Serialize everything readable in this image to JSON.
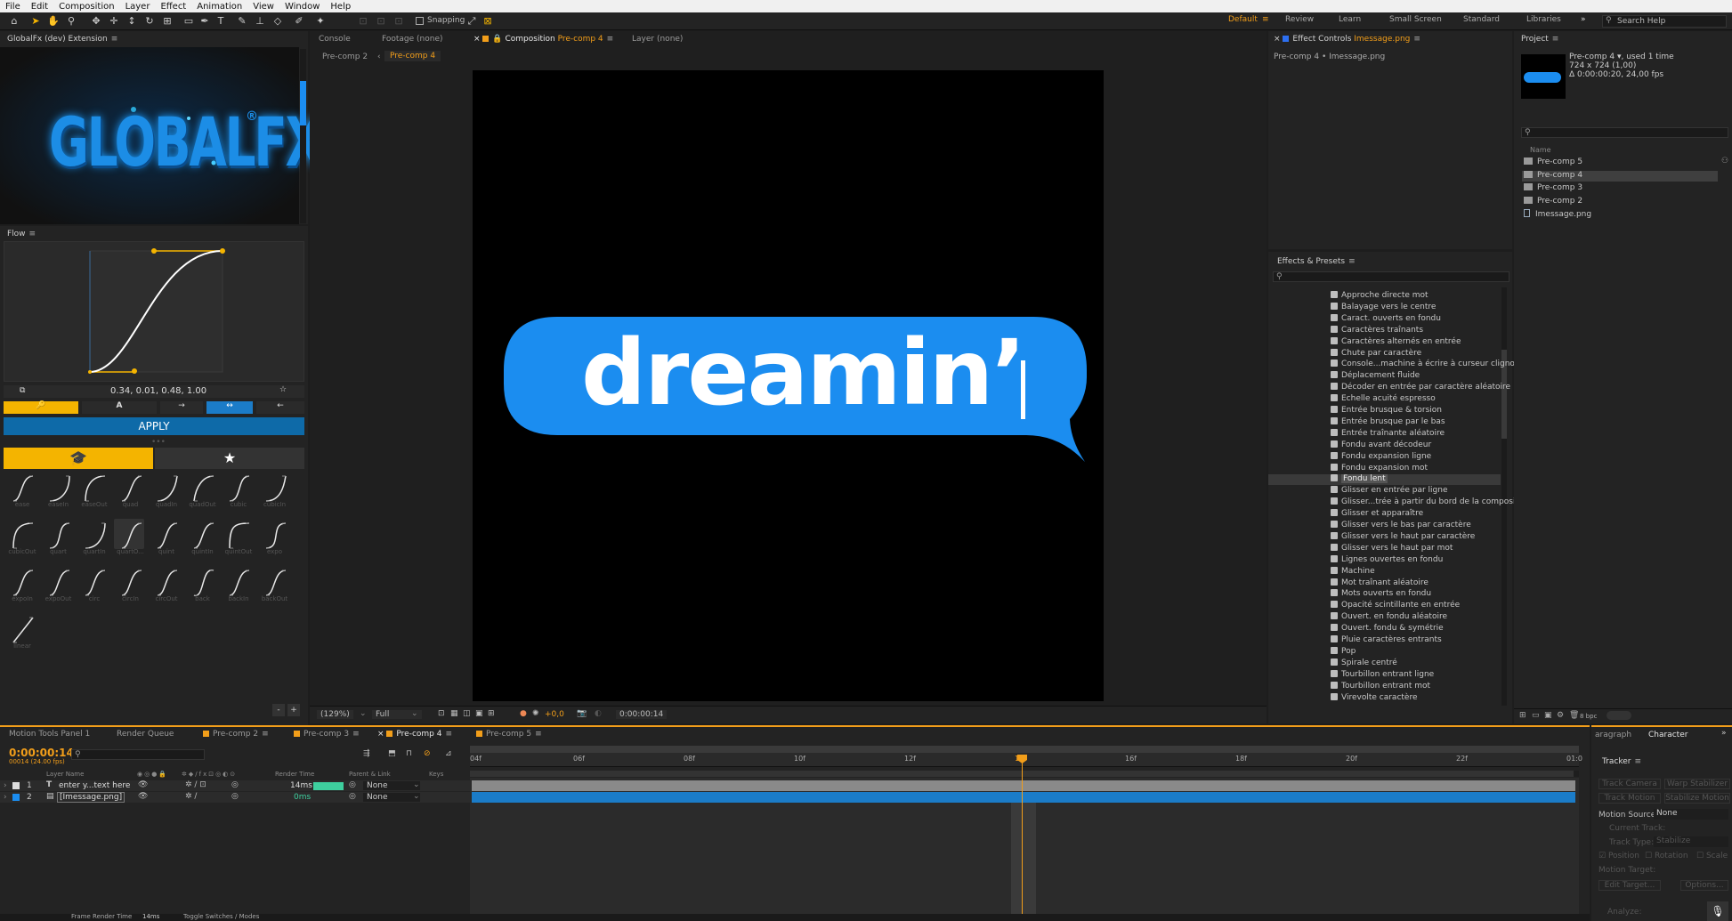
{
  "menu": [
    "File",
    "Edit",
    "Composition",
    "Layer",
    "Effect",
    "Animation",
    "View",
    "Window",
    "Help"
  ],
  "toolbar": {
    "snapping": "Snapping"
  },
  "workspaces": [
    "Default",
    "Review",
    "Learn",
    "Small Screen",
    "Standard",
    "Libraries"
  ],
  "search_help": "Search Help",
  "globalfx": {
    "title": "GlobalFx (dev) Extension",
    "logo": "GLOBALFX",
    "reg": "®"
  },
  "flow": {
    "title": "Flow",
    "values": "0.34, 0.01, 0.48, 1.00",
    "apply": "APPLY",
    "curves": [
      "ease",
      "easeIn",
      "easeOut",
      "quad",
      "quadIn",
      "quadOut",
      "cubic",
      "cubicIn",
      "cubicOut",
      "quart",
      "quartIn",
      "quartO...",
      "quint",
      "quintIn",
      "quintOut",
      "expo",
      "expoIn",
      "expoOut",
      "circ",
      "circIn",
      "circOut",
      "back",
      "backIn",
      "backOut",
      "linear"
    ]
  },
  "viewer": {
    "tabs": [
      "Console",
      "Footage",
      "(none)",
      "Composition",
      "Pre-comp 4",
      "Layer",
      "(none)"
    ],
    "breadcrumbs": [
      "Pre-comp 2",
      "Pre-comp 4"
    ],
    "canvas_text": "dreamin’",
    "zoom": "(129%)",
    "resolution": "Full",
    "offset": "+0,0",
    "timecode": "0:00:00:14"
  },
  "effect_controls": {
    "title": "Effect Controls",
    "file": "Imessage.png",
    "subtitle": "Pre-comp 4 • Imessage.png"
  },
  "effects": {
    "title": "Effects & Presets",
    "items": [
      "Approche directe mot",
      "Balayage vers le centre",
      "Caract. ouverts en fondu",
      "Caractères traînants",
      "Caractères alternés en entrée",
      "Chute par caractère",
      "Console...machine à écrire à curseur clignotant",
      "Déplacement fluide",
      "Décoder en entrée par caractère aléatoire",
      "Echelle acuité espresso",
      "Entrée brusque & torsion",
      "Entrée brusque par le bas",
      "Entrée traînante aléatoire",
      "Fondu avant décodeur",
      "Fondu expansion ligne",
      "Fondu expansion mot",
      "Fondu lent",
      "Glisser en entrée par ligne",
      "Glisser...trée à partir du bord de la composition",
      "Glisser et apparaître",
      "Glisser vers le bas par caractère",
      "Glisser vers le haut par caractère",
      "Glisser vers le haut par mot",
      "Lignes ouvertes en fondu",
      "Machine",
      "Mot traînant aléatoire",
      "Mots ouverts en fondu",
      "Opacité scintillante en entrée",
      "Ouvert. en fondu aléatoire",
      "Ouvert. fondu & symétrie",
      "Pluie caractères entrants",
      "Pop",
      "Spirale centré",
      "Tourbillon entrant ligne",
      "Tourbillon entrant mot",
      "Virevolte caractère"
    ],
    "selected": "Fondu lent"
  },
  "project": {
    "title": "Project",
    "comp": "Pre-comp 4",
    "used": ", used 1 time",
    "dims": "724 x 724 (1,00)",
    "duration": "Δ 0:00:00:20, 24,00 fps",
    "name_header": "Name",
    "items": [
      "Pre-comp 5",
      "Pre-comp 4",
      "Pre-comp 3",
      "Pre-comp 2",
      "Imessage.png"
    ],
    "selected": "Pre-comp 4",
    "bpc": "8 bpc"
  },
  "timeline": {
    "tabs": [
      "Motion Tools Panel 1",
      "Render Queue",
      "Pre-comp 2",
      "Pre-comp 3",
      "Pre-comp 4",
      "Pre-comp 5"
    ],
    "time": "0:00:00:14",
    "frames": "00014 (24.00 fps)",
    "headers": {
      "layer_name": "Layer Name",
      "render_time": "Render Time",
      "parent": "Parent & Link",
      "keys": "Keys"
    },
    "layers": [
      {
        "num": "1",
        "type": "T",
        "name": "enter y...text here",
        "render": "14ms",
        "parent": "None"
      },
      {
        "num": "2",
        "type": "img",
        "name": "[Imessage.png]",
        "render": "0ms",
        "parent": "None"
      }
    ],
    "ruler": [
      "04f",
      "06f",
      "08f",
      "10f",
      "12f",
      "14f",
      "16f",
      "18f",
      "20f",
      "22f",
      "01:0"
    ],
    "footer": {
      "frame_render": "Frame Render Time",
      "frame_render_val": "14ms",
      "toggle": "Toggle Switches / Modes"
    }
  },
  "right_panel": {
    "tabs": [
      "aragraph",
      "Character"
    ],
    "tracker": "Tracker",
    "track_camera": "Track Camera",
    "warp_stabilizer": "Warp Stabilizer",
    "track_motion": "Track Motion",
    "stabilize_motion": "Stabilize Motion",
    "motion_source": "Motion Source:",
    "motion_source_val": "None",
    "current_track": "Current Track:",
    "track_type": "Track Type:",
    "track_type_val": "Stabilize",
    "position": "Position",
    "rotation": "Rotation",
    "scale": "Scale",
    "motion_target": "Motion Target:",
    "edit_target": "Edit Target...",
    "options": "Options...",
    "analyze": "Analyze:"
  },
  "colors": {
    "accent": "#f29e1a",
    "blue": "#1b8df0",
    "selection": "#0e6aa8"
  }
}
